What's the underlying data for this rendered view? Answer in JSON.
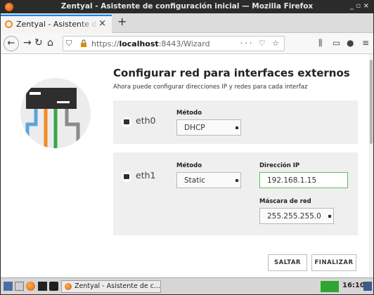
{
  "window": {
    "title": "Zentyal - Asistente de configuración inicial — Mozilla Firefox",
    "controls": "_ ▫ ×"
  },
  "browser": {
    "tab_label": "Zentyal - Asistente de configuración inicial",
    "tab_close": "×",
    "new_tab": "+",
    "url_prefix": "https://",
    "url_host": "localhost",
    "url_rest": ":8443/Wizard",
    "url_actions": "··· ♡ ☆"
  },
  "page": {
    "title": "Configurar red para interfaces externos",
    "subtitle": "Ahora puede configurar direcciones IP y redes para cada interfaz",
    "interfaces": [
      {
        "name": "eth0",
        "method_label": "Método",
        "method_value": "DHCP"
      },
      {
        "name": "eth1",
        "method_label": "Método",
        "method_value": "Static",
        "ip_label": "Dirección IP",
        "ip_value": "192.168.1.15",
        "mask_label": "Máscara de red",
        "mask_value": "255.255.255.0"
      }
    ],
    "skip_label": "SALTAR",
    "finish_label": "FINALIZAR"
  },
  "taskbar": {
    "task_label": "Zentyal - Asistente de c...",
    "clock": "16:10"
  },
  "colors": {
    "tab_accent": "#0a84ff",
    "input_focus": "#5bbf5b",
    "tray_green": "#2fa52f"
  }
}
